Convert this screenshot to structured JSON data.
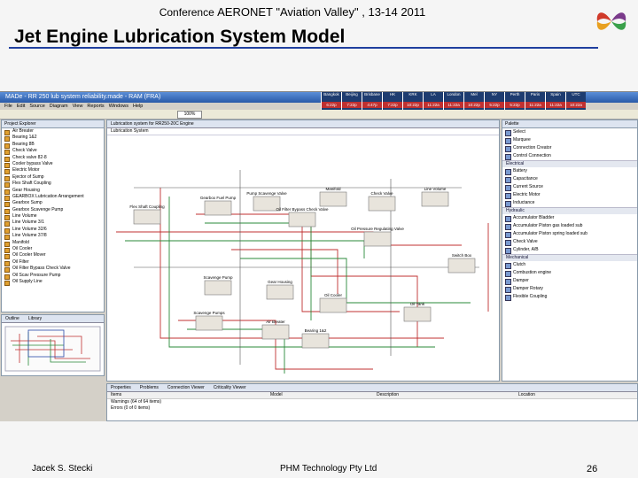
{
  "header": {
    "conference_prefix": "Conference",
    "conference_name": "AERONET \"Aviation Valley\" , 13-14 2011",
    "title": "Jet Engine Lubrication System Model"
  },
  "footer": {
    "author": "Jacek S. Stecki",
    "company": "PHM Technology Pty Ltd",
    "page_number": "26"
  },
  "app": {
    "window_title": "MADe - RR 250 lub system reliability.made - RAM (FRA)",
    "menu": [
      "File",
      "Edit",
      "Source",
      "Diagram",
      "View",
      "Reports",
      "Windows",
      "Help"
    ],
    "zoom": "100%",
    "clocks": [
      {
        "city": "Bangkok",
        "time": "6:22p"
      },
      {
        "city": "Beijing",
        "time": "7:22p"
      },
      {
        "city": "Brisbane",
        "time": "4:47p"
      },
      {
        "city": "HK",
        "time": "7:22p"
      },
      {
        "city": "KRK",
        "time": "10:22p"
      },
      {
        "city": "LA",
        "time": "11:22a"
      },
      {
        "city": "London",
        "time": "11:22a"
      },
      {
        "city": "Mel",
        "time": "10:22p"
      },
      {
        "city": "NY",
        "time": "5:22p"
      },
      {
        "city": "Perth",
        "time": "5:22p"
      },
      {
        "city": "Paris",
        "time": "11:22a"
      },
      {
        "city": "Spain",
        "time": "11:22a"
      },
      {
        "city": "UTC",
        "time": "10:22a"
      }
    ],
    "project_explorer": {
      "title": "Project Explorer",
      "items": [
        "Air Breater",
        "Bearing 1&2",
        "Bearing 8B",
        "Check Valve",
        "Check valve 82-8",
        "Cooler bypass Valve",
        "Electric Motor",
        "Ejector of Sump",
        "Flex Shaft Coupling",
        "Gear Housing",
        "GEARBOX Lubrication Arrangement",
        "Gearbox Sump",
        "Gearbox Scavenge Pump",
        "Line Volume",
        "Line Volume 3/1",
        "Line Volume 32/6",
        "Line Volume 37/8",
        "Manifold",
        "Oil Cooler",
        "Oil Cooler Mover",
        "Oil Filter",
        "Oil Filter Bypass Check Valve",
        "Oil Scav Pressure Pump",
        "Oil Supply Line"
      ]
    },
    "outline": {
      "tabs": [
        "Outline",
        "Library"
      ]
    },
    "editor": {
      "tab": "Lubrication system for RR250-20C Engine",
      "breadcrumb": "Lubrication System"
    },
    "diagram_labels": [
      "Flex Shaft Coupling",
      "Gearbox Fuel Pump",
      "Pump Scavenge Valve",
      "Oil Filter Bypass Check Valve",
      "Manifold",
      "Check Valve",
      "Line Volume",
      "Oil Pressure Regulating Valve",
      "Scavenge Pump",
      "Gear Housing",
      "Oil Cooler",
      "Oil Tank",
      "Scavenge Pumps",
      "Air Breater",
      "Bearing 1&2",
      "Switch Box"
    ],
    "palette": {
      "title": "Palette",
      "tools": [
        "Select",
        "Marquee",
        "Connection Creator",
        "Control Connection"
      ],
      "sections": [
        {
          "name": "Electrical",
          "items": [
            "Battery",
            "Capacitance",
            "Current Source",
            "Electric Motor",
            "Inductance"
          ]
        },
        {
          "name": "Hydraulic",
          "items": [
            "Accumulator Bladder",
            "Accumulator Piston gas loaded sub",
            "Accumulator Piston spring loaded sub",
            "Check Valve",
            "Cylinder, A/B"
          ]
        },
        {
          "name": "Mechanical",
          "items": [
            "Clutch",
            "Combustion engine",
            "Damper",
            "Damper Rotary",
            "Flexible Coupling"
          ]
        }
      ]
    },
    "bottom_panel": {
      "tabs": [
        "Properties",
        "Problems",
        "Connection Viewer",
        "Criticality Viewer"
      ],
      "columns": [
        "Items",
        "Model",
        "Description",
        "Location"
      ],
      "rows": [
        "Warnings (64 of 64 items)",
        "Errors (0 of 0 items)"
      ]
    }
  }
}
